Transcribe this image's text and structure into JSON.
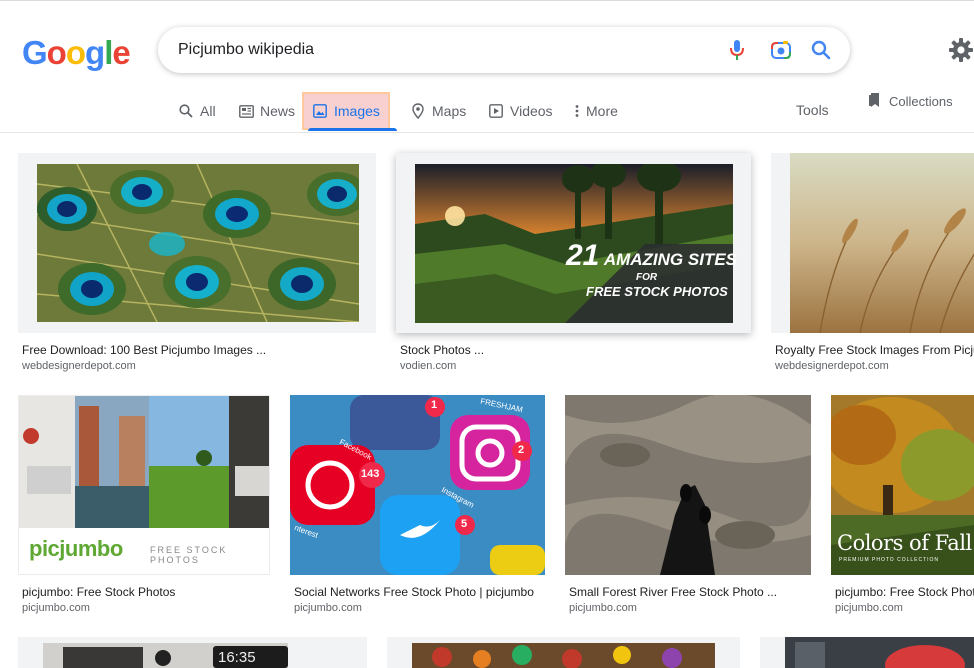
{
  "logo": {
    "letters": [
      "G",
      "o",
      "o",
      "g",
      "l",
      "e"
    ]
  },
  "search": {
    "value": "Picjumbo wikipedia"
  },
  "tabs": [
    {
      "label": "All"
    },
    {
      "label": "News"
    },
    {
      "label": "Images"
    },
    {
      "label": "Maps"
    },
    {
      "label": "Videos"
    },
    {
      "label": "More"
    }
  ],
  "tools_label": "Tools",
  "collections_label": "Collections",
  "results": [
    {
      "title": "Free Download: 100 Best Picjumbo Images ...",
      "site": "webdesignerdepot.com"
    },
    {
      "title": "Stock Photos ...",
      "site": "vodien.com",
      "overlay": {
        "num": "21",
        "big": "AMAZING SITES",
        "for": "FOR",
        "small": "FREE STOCK PHOTOS"
      }
    },
    {
      "title": "Royalty Free Stock Images From Picjumbo",
      "site": "webdesignerdepot.com"
    },
    {
      "title": "picjumbo: Free Stock Photos",
      "site": "picjumbo.com",
      "overlay": {
        "brand": "picjumbo",
        "tag": "FREE STOCK PHOTOS"
      }
    },
    {
      "title": "Social Networks Free Stock Photo | picjumbo",
      "site": "picjumbo.com",
      "overlay": {
        "fb_badge": "1",
        "ig_badge": "2",
        "p_badge": "143",
        "tw_badge": "5",
        "freshjam": "FRESHJAM",
        "facebook": "Facebook",
        "instagram": "Instagram",
        "interest": "nterest"
      }
    },
    {
      "title": "Small Forest River Free Stock Photo ...",
      "site": "picjumbo.com"
    },
    {
      "title": "picjumbo: Free Stock Photos",
      "site": "picjumbo.com",
      "overlay": {
        "big": "Colors of Fall",
        "small": "PREMIUM PHOTO COLLECTION"
      }
    },
    {
      "overlay": {
        "clock": "16:35"
      }
    }
  ]
}
